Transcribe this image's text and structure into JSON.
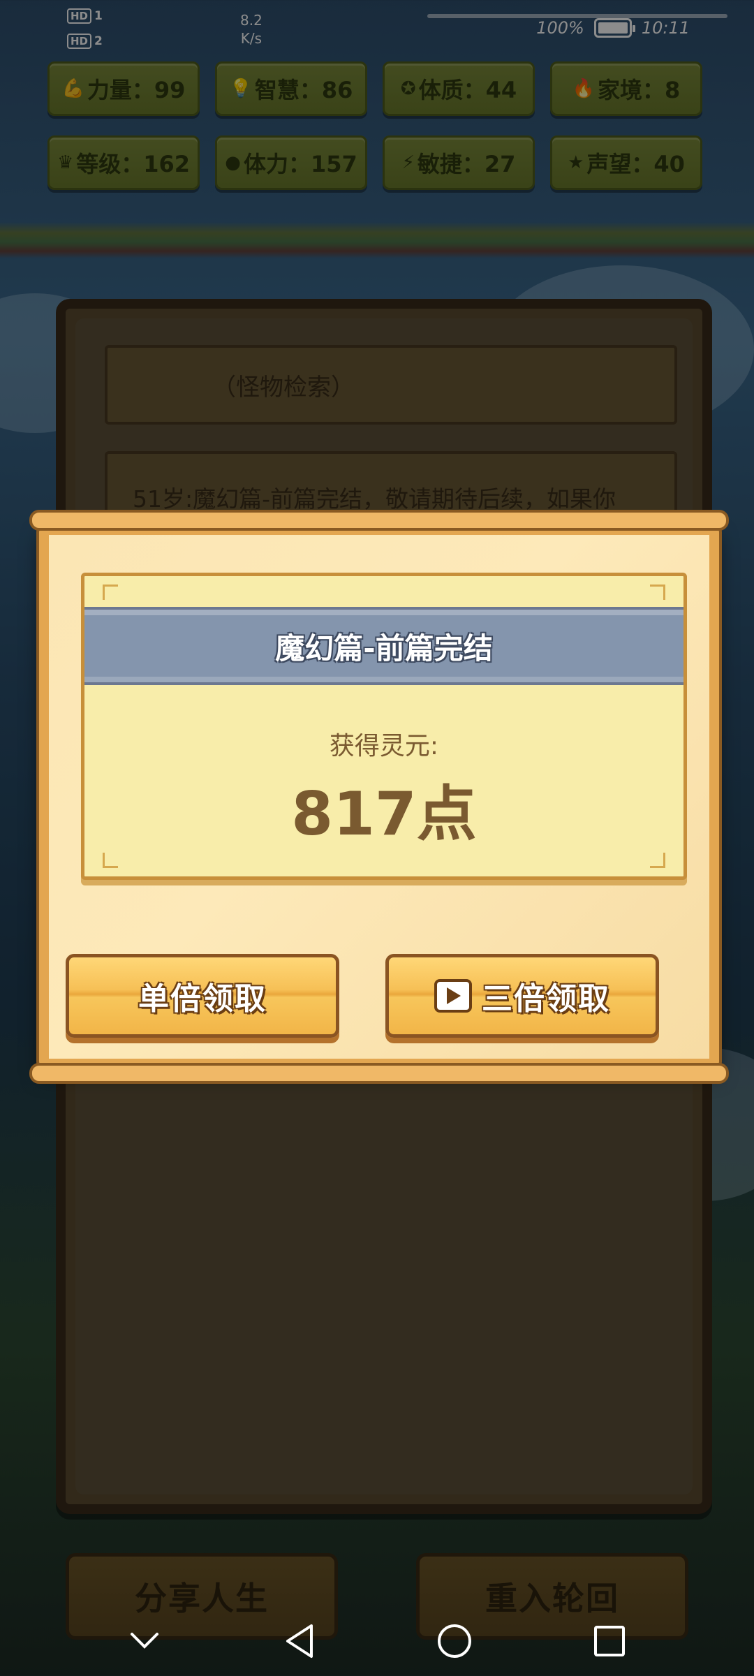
{
  "status_bar": {
    "hd1": "HD",
    "hd1_num": "1",
    "hd2": "HD",
    "hd2_num": "2",
    "net_speed_value": "8.2",
    "net_speed_unit": "K/s",
    "battery": "100%",
    "time": "10:11"
  },
  "stats": [
    {
      "icon": "muscle-icon",
      "glyph": "💪",
      "label": "力量：99"
    },
    {
      "icon": "lightbulb-icon",
      "glyph": "💡",
      "label": "智慧：86"
    },
    {
      "icon": "shield-icon",
      "glyph": "✪",
      "label": "体质：44"
    },
    {
      "icon": "home-icon",
      "glyph": "🔥",
      "label": "家境：8"
    },
    {
      "icon": "crown-icon",
      "glyph": "♛",
      "label": "等级：162"
    },
    {
      "icon": "heart-icon",
      "glyph": "●",
      "label": "体力：157"
    },
    {
      "icon": "lightning-icon",
      "glyph": "⚡",
      "label": "敏捷：27"
    },
    {
      "icon": "star-icon",
      "glyph": "★",
      "label": "声望：40"
    }
  ],
  "background": {
    "search_label": "（怪物检索）",
    "log_line": "51岁:魔幻篇-前篇完结，敬请期待后续，如果你"
  },
  "dialog": {
    "title": "魔幻篇-前篇完结",
    "reward_label": "获得灵元:",
    "reward_value": "817点",
    "single_button": "单倍领取",
    "triple_button": "三倍领取"
  },
  "bottom_buttons": {
    "share": "分享人生",
    "restart": "重入轮回"
  },
  "colors": {
    "dialog_frame": "#e3a650",
    "title_bar": "#8495ad",
    "notice_bg": "#f8edaa",
    "button_wood": "#f6c056",
    "text_brown": "#7a5a30"
  }
}
